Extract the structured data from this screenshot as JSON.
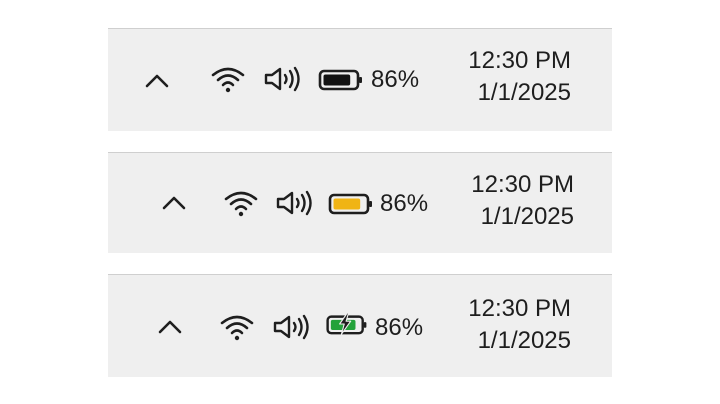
{
  "trays": [
    {
      "battery_state": "normal",
      "battery_fill_color": "#111111",
      "battery_percent_value": 86,
      "battery_percent_label": "86%",
      "time": "12:30 PM",
      "date": "1/1/2025",
      "icons": [
        "chevron-up-icon",
        "wifi-icon",
        "volume-icon",
        "battery-icon"
      ]
    },
    {
      "battery_state": "saver",
      "battery_fill_color": "#f0b414",
      "battery_percent_value": 86,
      "battery_percent_label": "86%",
      "time": "12:30 PM",
      "date": "1/1/2025",
      "icons": [
        "chevron-up-icon",
        "wifi-icon",
        "volume-icon",
        "battery-saver-icon"
      ]
    },
    {
      "battery_state": "charging",
      "battery_fill_color": "#23a23a",
      "battery_percent_value": 86,
      "battery_percent_label": "86%",
      "time": "12:30 PM",
      "date": "1/1/2025",
      "icons": [
        "chevron-up-icon",
        "wifi-icon",
        "volume-icon",
        "battery-charging-icon"
      ]
    }
  ],
  "colors": {
    "tray_background": "#efefef",
    "tray_border": "#cfcfcf",
    "text": "#1e1e1e"
  }
}
